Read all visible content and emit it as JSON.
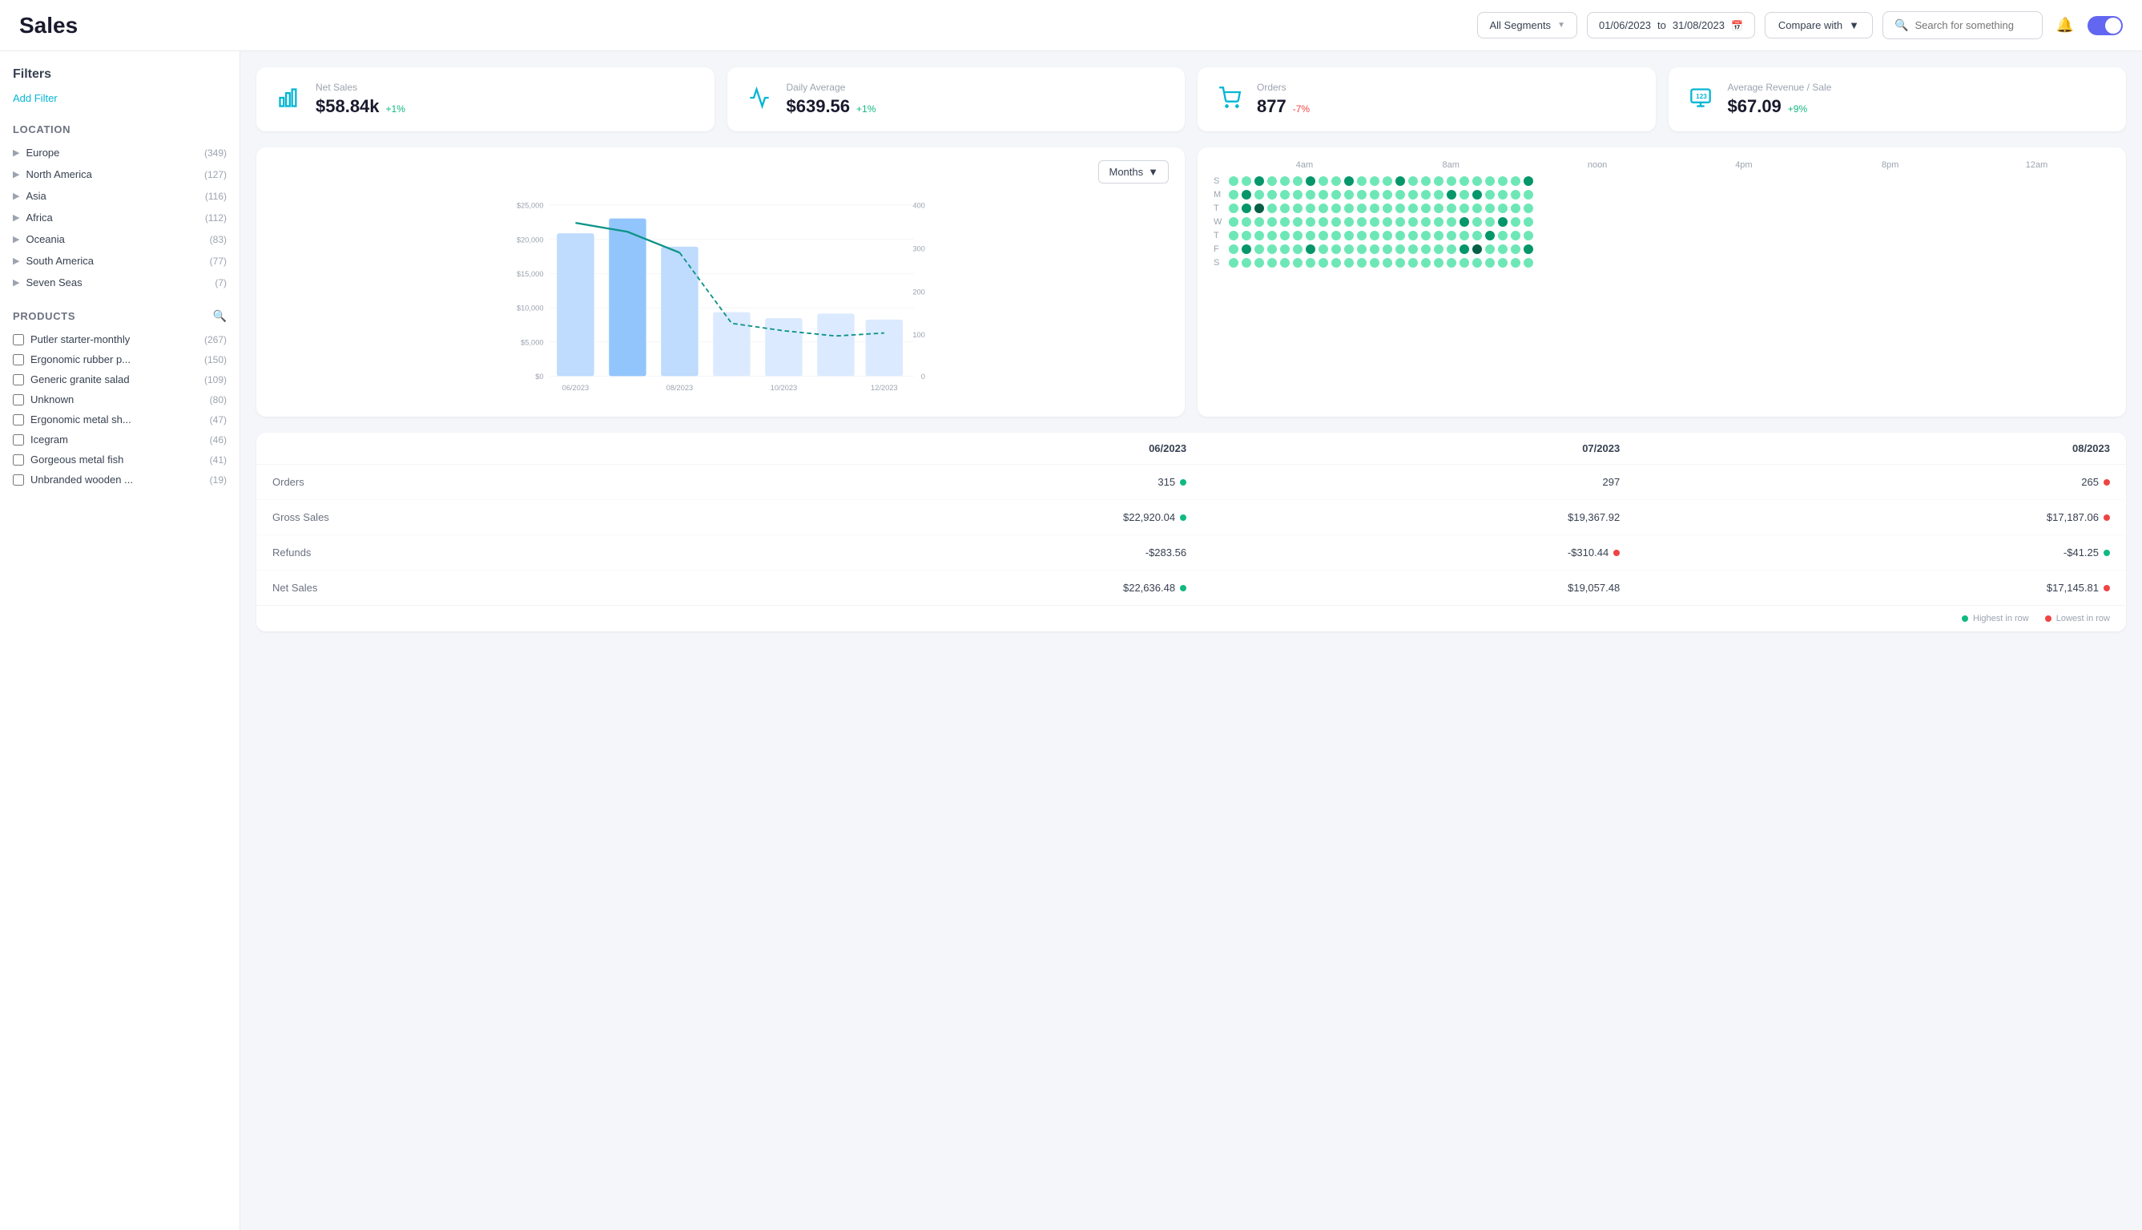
{
  "header": {
    "title": "Sales",
    "segment_label": "All Segments",
    "date_from": "01/06/2023",
    "date_to": "31/08/2023",
    "compare_label": "Compare with",
    "search_placeholder": "Search for something"
  },
  "kpis": [
    {
      "id": "net-sales",
      "label": "Net Sales",
      "value": "$58.84k",
      "change": "+1%",
      "positive": true,
      "icon": "📊"
    },
    {
      "id": "daily-average",
      "label": "Daily Average",
      "value": "$639.56",
      "change": "+1%",
      "positive": true,
      "icon": "📈"
    },
    {
      "id": "orders",
      "label": "Orders",
      "value": "877",
      "change": "-7%",
      "positive": false,
      "icon": "🛒"
    },
    {
      "id": "avg-revenue",
      "label": "Average Revenue / Sale",
      "value": "$67.09",
      "change": "+9%",
      "positive": true,
      "icon": "🔢"
    }
  ],
  "chart": {
    "period_label": "Months",
    "y_labels": [
      "$25,000",
      "$20,000",
      "$15,000",
      "$10,000",
      "$5,000",
      "$0"
    ],
    "y2_labels": [
      "400",
      "300",
      "200",
      "100",
      "0"
    ],
    "x_labels": [
      "06/2023",
      "08/2023",
      "10/2023",
      "12/2023"
    ]
  },
  "heatmap": {
    "time_labels": [
      "4am",
      "8am",
      "noon",
      "4pm",
      "8pm",
      "12am"
    ],
    "days": [
      {
        "label": "S",
        "id": "sunday"
      },
      {
        "label": "M",
        "id": "monday"
      },
      {
        "label": "T",
        "id": "tuesday"
      },
      {
        "label": "W",
        "id": "wednesday"
      },
      {
        "label": "T",
        "id": "thursday"
      },
      {
        "label": "F",
        "id": "friday"
      },
      {
        "label": "S",
        "id": "saturday"
      }
    ]
  },
  "filters": {
    "title": "Filters",
    "add_filter": "Add Filter"
  },
  "location": {
    "title": "Location",
    "items": [
      {
        "name": "Europe",
        "count": "(349)"
      },
      {
        "name": "North America",
        "count": "(127)"
      },
      {
        "name": "Asia",
        "count": "(116)"
      },
      {
        "name": "Africa",
        "count": "(112)"
      },
      {
        "name": "Oceania",
        "count": "(83)"
      },
      {
        "name": "South America",
        "count": "(77)"
      },
      {
        "name": "Seven Seas",
        "count": "(7)"
      }
    ]
  },
  "products": {
    "title": "Products",
    "items": [
      {
        "name": "Putler starter-monthly",
        "count": "(267)"
      },
      {
        "name": "Ergonomic rubber p...",
        "count": "(150)"
      },
      {
        "name": "Generic granite salad",
        "count": "(109)"
      },
      {
        "name": "Unknown",
        "count": "(80)"
      },
      {
        "name": "Ergonomic metal sh...",
        "count": "(47)"
      },
      {
        "name": "Icegram",
        "count": "(46)"
      },
      {
        "name": "Gorgeous metal fish",
        "count": "(41)"
      },
      {
        "name": "Unbranded wooden ...",
        "count": "(19)"
      }
    ]
  },
  "table": {
    "columns": [
      "",
      "06/2023",
      "07/2023",
      "08/2023"
    ],
    "rows": [
      {
        "label": "Orders",
        "values": [
          {
            "val": "315",
            "dot": "green"
          },
          {
            "val": "297",
            "dot": null
          },
          {
            "val": "265",
            "dot": "red"
          }
        ]
      },
      {
        "label": "Gross Sales",
        "values": [
          {
            "val": "$22,920.04",
            "dot": "green"
          },
          {
            "val": "$19,367.92",
            "dot": null
          },
          {
            "val": "$17,187.06",
            "dot": "red"
          }
        ]
      },
      {
        "label": "Refunds",
        "values": [
          {
            "val": "-$283.56",
            "dot": null
          },
          {
            "val": "-$310.44",
            "dot": "red"
          },
          {
            "val": "-$41.25",
            "dot": "green"
          }
        ]
      },
      {
        "label": "Net Sales",
        "values": [
          {
            "val": "$22,636.48",
            "dot": "green"
          },
          {
            "val": "$19,057.48",
            "dot": null
          },
          {
            "val": "$17,145.81",
            "dot": "red"
          }
        ]
      }
    ],
    "legend_highest": "Highest in row",
    "legend_lowest": "Lowest in row"
  }
}
